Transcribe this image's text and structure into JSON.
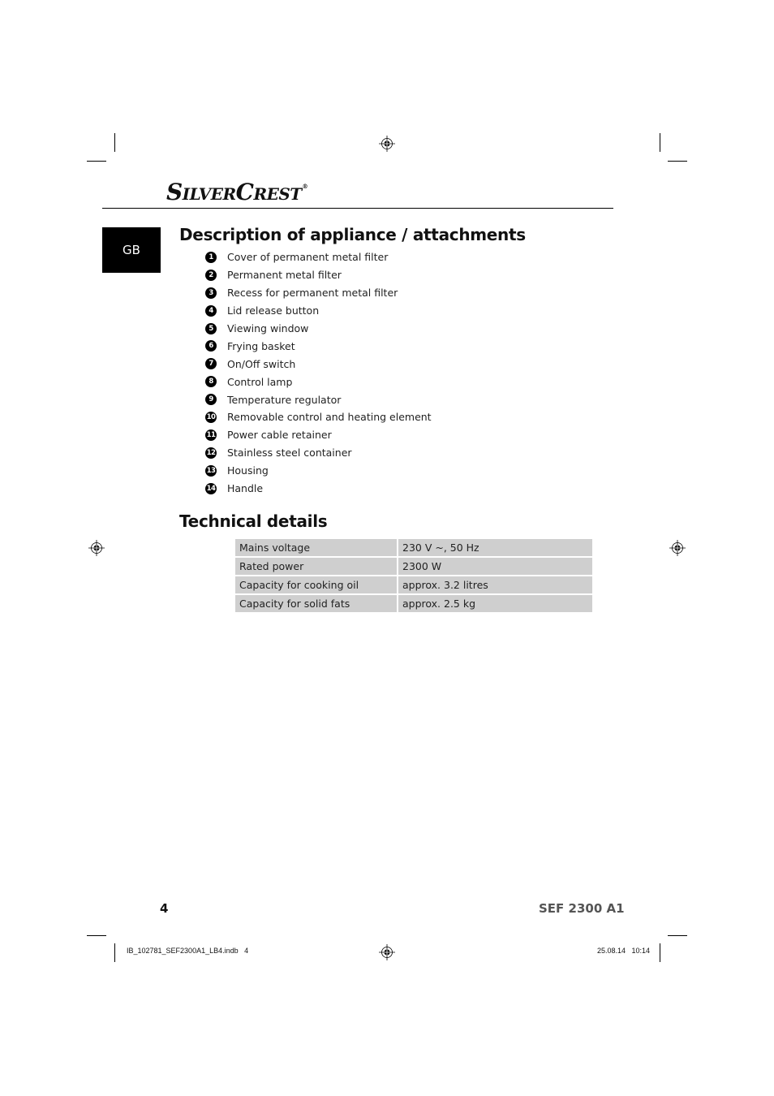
{
  "brand": {
    "logo_parts": {
      "s": "S",
      "ilver": "ILVER",
      "c": "C",
      "rest": "REST",
      "reg": "®"
    }
  },
  "language_tab": "GB",
  "description": {
    "heading": "Description of appliance / attachments",
    "items": [
      {
        "num": "1",
        "label": "Cover of permanent metal filter"
      },
      {
        "num": "2",
        "label": "Permanent metal filter"
      },
      {
        "num": "3",
        "label": "Recess for permanent metal filter"
      },
      {
        "num": "4",
        "label": "Lid release button"
      },
      {
        "num": "5",
        "label": "Viewing window"
      },
      {
        "num": "6",
        "label": "Frying basket"
      },
      {
        "num": "7",
        "label": "On/Off switch"
      },
      {
        "num": "8",
        "label": "Control lamp"
      },
      {
        "num": "9",
        "label": "Temperature regulator"
      },
      {
        "num": "10",
        "label": "Removable control and heating element"
      },
      {
        "num": "11",
        "label": "Power cable retainer"
      },
      {
        "num": "12",
        "label": "Stainless steel container"
      },
      {
        "num": "13",
        "label": "Housing"
      },
      {
        "num": "14",
        "label": "Handle"
      }
    ]
  },
  "technical": {
    "heading": "Technical details",
    "rows": [
      {
        "key": "Mains voltage",
        "value": "230 V ~, 50 Hz"
      },
      {
        "key": "Rated power",
        "value": "2300 W"
      },
      {
        "key": "Capacity for cooking oil",
        "value": "approx. 3.2 litres"
      },
      {
        "key": "Capacity for solid fats",
        "value": "approx. 2.5 kg"
      }
    ]
  },
  "footer": {
    "page_number": "4",
    "model": "SEF 2300 A1",
    "slug_file": "IB_102781_SEF2300A1_LB4.indb   4",
    "slug_date": "25.08.14   10:14"
  },
  "colors": {
    "table_cell": "#cfcfcf",
    "model_text": "#555555",
    "tab_background": "#000000"
  }
}
